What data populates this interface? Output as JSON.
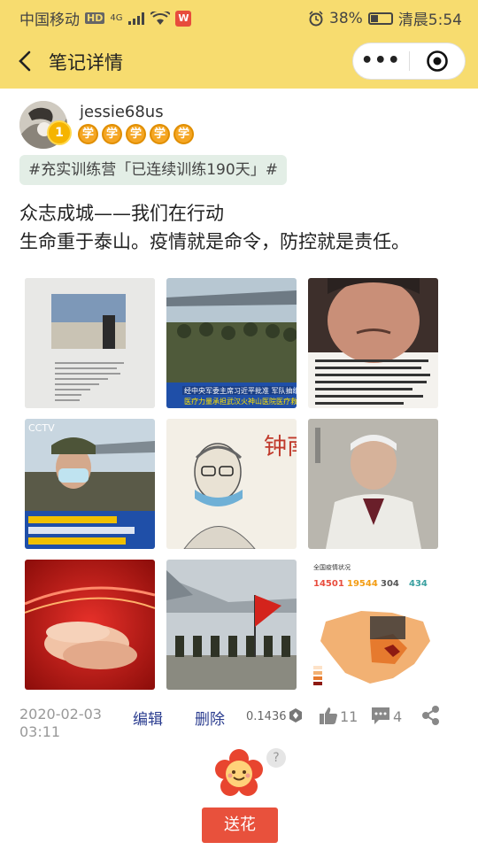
{
  "status_bar": {
    "carrier": "中国移动",
    "network_badge": "HD",
    "signal_label": "4G",
    "app_badge": "W",
    "battery_text": "38%",
    "time": "清晨5:54",
    "battery_level": 0.38
  },
  "nav": {
    "back_icon": "chevron-left-icon",
    "title": "笔记详情",
    "more_icon": "more-dots",
    "target_icon": "target-icon"
  },
  "author": {
    "username": "jessie68us",
    "medal": "1",
    "badges": [
      "学",
      "学",
      "学",
      "学",
      "学"
    ]
  },
  "tag": "#充实训练营「已连续训练190天」#",
  "content": {
    "line1": "众志成城——我们在行动",
    "line2": "生命重于泰山。疫情就是命令，防控就是责任。"
  },
  "photos": [
    {
      "name": "photo-1"
    },
    {
      "name": "photo-2",
      "caption": "经中央军委主席习近平批准 军队抽组医疗力量承担武汉火神山医院医疗救治任务"
    },
    {
      "name": "photo-3",
      "caption": "延长假期不是为了让大家出门的。太阳出来看着外面的车多了起来，真是头疼。元宵节之前控制不住，国家就难了。一旦被划入疫区国，外贸放了，股票崩了，工厂关了……"
    },
    {
      "name": "photo-4",
      "caption": "我们是中国人民解放军 我们为大家的安全保驾护航"
    },
    {
      "name": "photo-5",
      "caption": "钟南山"
    },
    {
      "name": "photo-6"
    },
    {
      "name": "photo-7"
    },
    {
      "name": "photo-8"
    },
    {
      "name": "photo-9",
      "caption": "全国疫情状况",
      "stats": [
        "14501",
        "19544",
        "304",
        "434"
      ]
    }
  ],
  "meta": {
    "date": "2020-02-03",
    "time": "03:11",
    "edit": "编辑",
    "delete": "删除",
    "score": "0.1436",
    "likes": "11",
    "comments": "4"
  },
  "flower": {
    "help": "?",
    "send": "送花"
  },
  "colors": {
    "header_bg": "#f7dc6f",
    "link": "#2a3c8f",
    "send_button": "#e8513c",
    "tag_bg": "#e3eee6"
  }
}
